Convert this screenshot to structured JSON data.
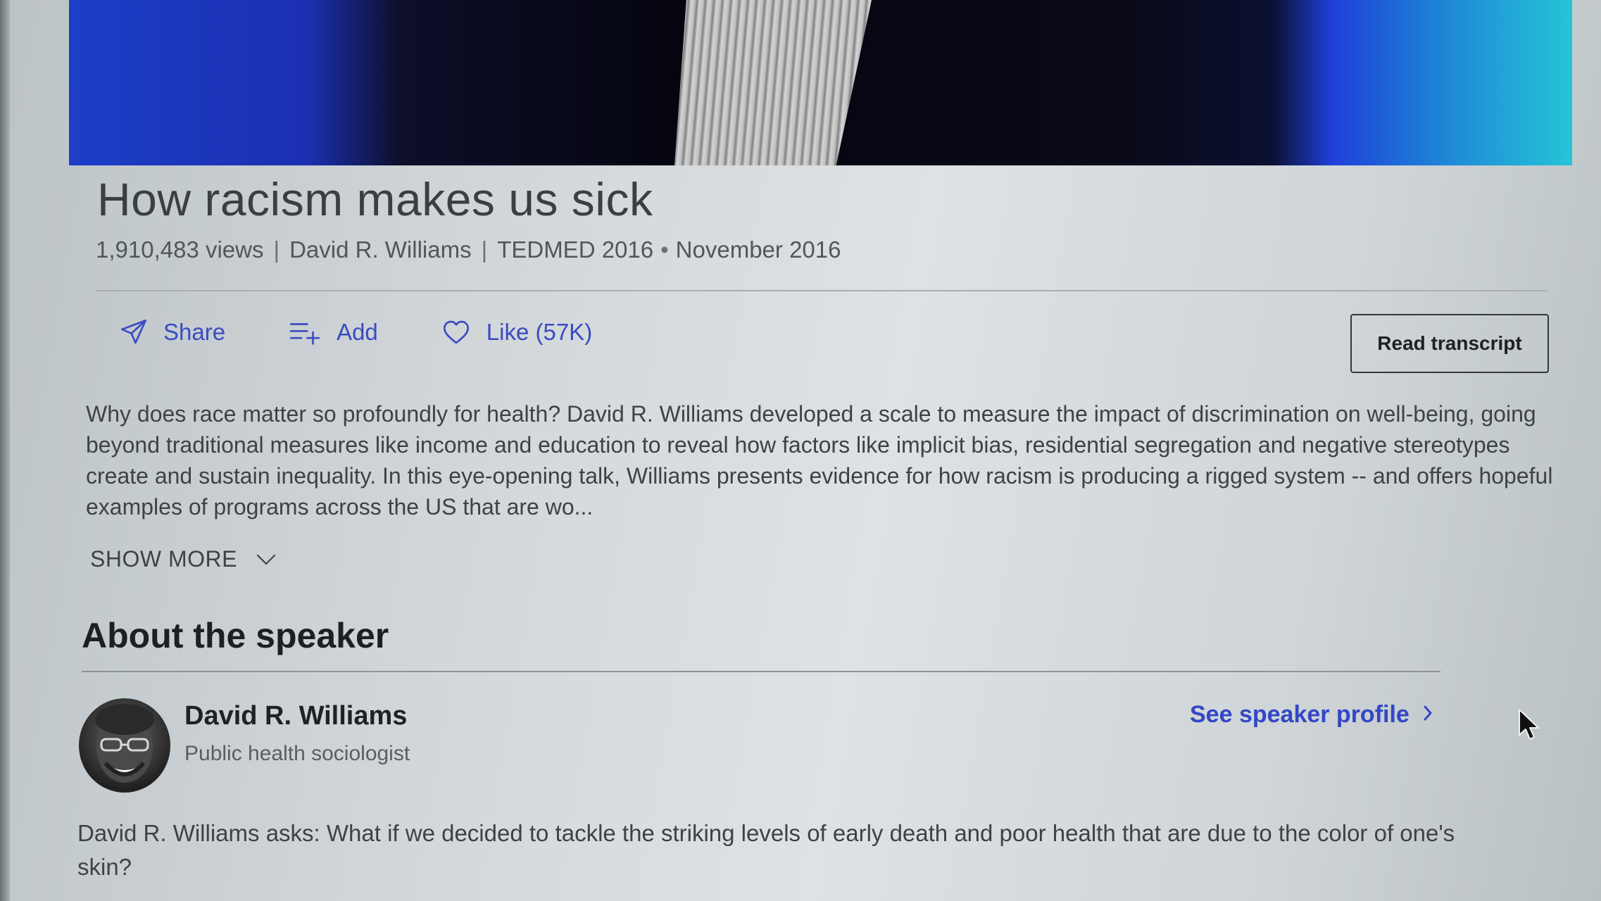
{
  "talk": {
    "title": "How racism makes us sick",
    "views": "1,910,483 views",
    "speaker": "David R. Williams",
    "event": "TEDMED 2016",
    "date_sep": "•",
    "date": "November 2016",
    "sep": "|"
  },
  "actions": {
    "share_label": "Share",
    "add_label": "Add",
    "like_label": "Like (57K)",
    "transcript_label": "Read transcript"
  },
  "description": {
    "text": "Why does race matter so profoundly for health? David R. Williams developed a scale to measure the impact of discrimination on well-being, going beyond traditional measures like income and education to reveal how factors like implicit bias, residential segregation and negative stereotypes create and sustain inequality. In this eye-opening talk, Williams presents evidence for how racism is producing a rigged system -- and offers hopeful examples of programs across the US that are wo...",
    "show_more_label": "SHOW MORE"
  },
  "about": {
    "heading": "About the speaker",
    "name": "David R. Williams",
    "role": "Public health sociologist",
    "profile_link": "See speaker profile",
    "bio": "David R. Williams asks: What if we decided to tackle the striking levels of early death and poor health that are due to the color of one's skin?"
  },
  "colors": {
    "accent": "#3347c6",
    "text": "#3d4246"
  },
  "icons": {
    "share": "paper-plane-icon",
    "add": "playlist-add-icon",
    "like": "heart-icon",
    "show_more": "chevron-down-icon",
    "profile": "chevron-right-icon"
  }
}
